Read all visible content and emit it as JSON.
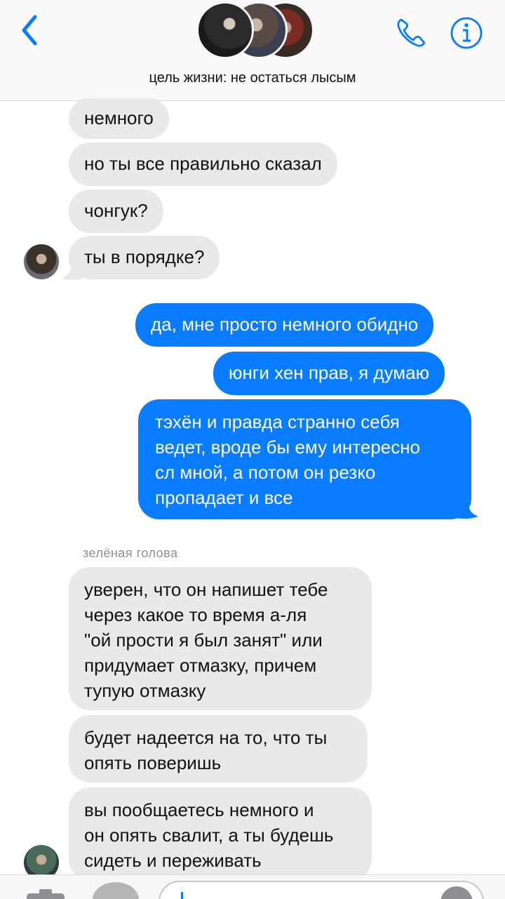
{
  "header": {
    "back_icon": "chevron-left-icon",
    "call_icon": "phone-icon",
    "info_icon": "info-icon",
    "title": "цель жизни: не остаться лысым",
    "accent_color": "#0a7cff"
  },
  "messages": [
    {
      "dir": "in",
      "text": "немного"
    },
    {
      "dir": "in",
      "text": "но ты все правильно сказал"
    },
    {
      "dir": "in",
      "text": "чонгук?"
    },
    {
      "dir": "in",
      "text": "ты в порядке?"
    },
    {
      "dir": "out",
      "text": "да, мне просто немного обидно"
    },
    {
      "dir": "out",
      "text": "юнги хен прав, я думаю"
    },
    {
      "dir": "out",
      "lines": [
        "тэхён и правда странно себя",
        "ведет, вроде бы ему интересно",
        "сл мной, а потом он резко",
        "пропадает и все"
      ]
    },
    {
      "dir": "in",
      "lines": [
        "уверен, что он напишет тебе",
        "через какое то время а-ля",
        "\"ой прости я был занят\" или",
        "придумает отмазку, причем",
        "тупую отмазку"
      ]
    },
    {
      "dir": "in",
      "lines": [
        "будет надеется на то, что ты",
        "опять поверишь"
      ]
    },
    {
      "dir": "in",
      "lines": [
        "вы пообщаетесь немного и",
        "он опять свалит, а ты будешь",
        "сидеть и переживать"
      ]
    }
  ],
  "sender_name": "зелёная голова",
  "colors": {
    "incoming_bubble": "#e9e9eb",
    "outgoing_bubble": "#0a7cff"
  },
  "bottom_bar": {
    "camera_icon": "camera-icon",
    "apps_icon": "app-store-icon",
    "audio_icon": "audio-icon"
  }
}
